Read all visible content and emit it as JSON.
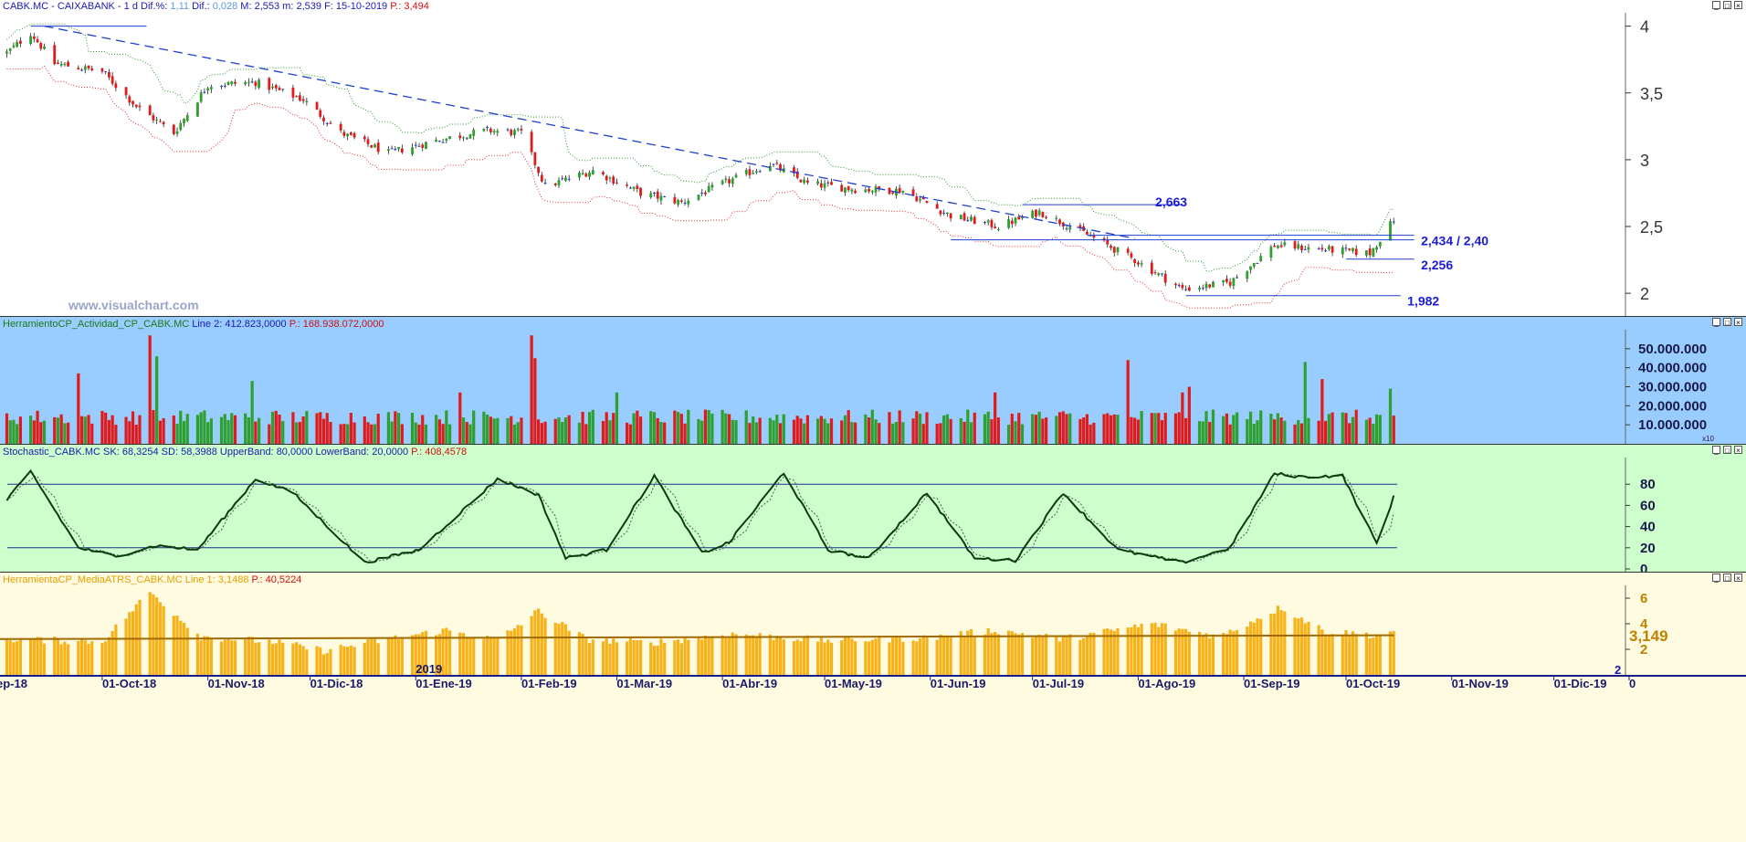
{
  "price_pane": {
    "title_symbol": "CABK.MC - CAIXABANK -",
    "title_period": "1 d",
    "dif_pct_label": "Dif.%:",
    "dif_pct_value": "1,11",
    "dif_label": "Dif.:",
    "dif_value": "0,028",
    "high_label": "M:",
    "high_value": "2,553",
    "low_label": "m:",
    "low_value": "2,539",
    "date_label": "F:",
    "date_value": "15-10-2019",
    "p_label": "P.:",
    "p_value": "3,494",
    "watermark": "www.visualchart.com",
    "yticks": [
      "4",
      "3,5",
      "3",
      "2,5",
      "2"
    ],
    "levels": [
      "2,663",
      "2,434 / 2,40",
      "2,256",
      "1,982"
    ]
  },
  "volume_pane": {
    "title": "HerramientoCP_Actividad_CP_CABK.MC",
    "line_label": "Line 2:",
    "line_value": "412.823,0000",
    "p_label": "P.:",
    "p_value": "168.938.072,0000",
    "yticks": [
      "50.000.000",
      "40.000.000",
      "30.000.000",
      "20.000.000",
      "10.000.000"
    ],
    "unit_tag": "x10"
  },
  "stoch_pane": {
    "title": "Stochastic_CABK.MC",
    "sk_label": "SK:",
    "sk_value": "68,3254",
    "sd_label": "SD:",
    "sd_value": "58,3988",
    "upper_label": "UpperBand:",
    "upper_value": "80,0000",
    "lower_label": "LowerBand:",
    "lower_value": "20,0000",
    "p_label": "P.:",
    "p_value": "408,4578",
    "yticks": [
      "80",
      "60",
      "40",
      "20",
      "0"
    ]
  },
  "atr_pane": {
    "title": "HerramientaCP_MediaATRS_CABK.MC",
    "line_label": "Line 1:",
    "line_value": "3,1488",
    "p_label": "P.:",
    "p_value": "40,5224",
    "yticks": [
      "6",
      "4",
      "2"
    ],
    "last_value": "3,149",
    "year_marker": "2019",
    "corner_value": "2"
  },
  "x_axis": {
    "labels": [
      "ep-18",
      "01-Oct-18",
      "01-Nov-18",
      "01-Dic-18",
      "01-Ene-19",
      "01-Feb-19",
      "01-Mar-19",
      "01-Abr-19",
      "01-May-19",
      "01-Jun-19",
      "01-Jul-19",
      "01-Ago-19",
      "01-Sep-19",
      "01-Oct-19",
      "01-Nov-19",
      "01-Dic-19",
      "0"
    ]
  },
  "colors": {
    "up": "#2ea02e",
    "down": "#e01b1b",
    "neutral": "#1f3fd1",
    "volume_bg": "#99ccff",
    "stoch_bg": "#ccffcc",
    "atr_bg": "#fffbe0",
    "atr_bar": "#f7b21a",
    "level_text": "#1b1bd9"
  },
  "chart_data": [
    {
      "type": "candlestick",
      "title": "CABK.MC - CAIXABANK - 1 d",
      "ylim": [
        1.83,
        4.1
      ],
      "trendline": {
        "from": [
          "2018-09-14",
          4.0
        ],
        "to": [
          "2019-07-31",
          2.41
        ]
      },
      "horizontal_levels": [
        2.663,
        2.434,
        2.4,
        2.256,
        1.982
      ],
      "close_anchors": [
        [
          "2018-09-03",
          3.8
        ],
        [
          "2018-09-10",
          3.95
        ],
        [
          "2018-09-17",
          3.72
        ],
        [
          "2018-10-01",
          3.66
        ],
        [
          "2018-10-11",
          3.4
        ],
        [
          "2018-10-22",
          3.2
        ],
        [
          "2018-11-01",
          3.56
        ],
        [
          "2018-11-15",
          3.58
        ],
        [
          "2018-11-29",
          3.45
        ],
        [
          "2018-12-10",
          3.2
        ],
        [
          "2018-12-24",
          3.05
        ],
        [
          "2019-01-08",
          3.15
        ],
        [
          "2019-01-22",
          3.22
        ],
        [
          "2019-02-01",
          3.2
        ],
        [
          "2019-02-08",
          2.8
        ],
        [
          "2019-02-22",
          2.92
        ],
        [
          "2019-03-08",
          2.75
        ],
        [
          "2019-03-20",
          2.68
        ],
        [
          "2019-04-01",
          2.82
        ],
        [
          "2019-04-15",
          2.97
        ],
        [
          "2019-04-26",
          2.82
        ],
        [
          "2019-05-10",
          2.78
        ],
        [
          "2019-05-24",
          2.77
        ],
        [
          "2019-06-07",
          2.58
        ],
        [
          "2019-06-21",
          2.5
        ],
        [
          "2019-07-03",
          2.61
        ],
        [
          "2019-07-17",
          2.44
        ],
        [
          "2019-07-31",
          2.25
        ],
        [
          "2019-08-14",
          2.03
        ],
        [
          "2019-08-28",
          2.08
        ],
        [
          "2019-09-10",
          2.36
        ],
        [
          "2019-09-24",
          2.33
        ],
        [
          "2019-10-08",
          2.3
        ],
        [
          "2019-10-15",
          2.55
        ]
      ]
    },
    {
      "type": "bar",
      "title": "HerramientoCP_Actividad_CP_CABK.MC",
      "ylim": [
        0,
        60000000
      ],
      "typical_range": [
        10000000,
        18000000
      ],
      "spikes": [
        [
          "2018-09-24",
          37000000
        ],
        [
          "2018-10-15",
          57000000
        ],
        [
          "2018-10-17",
          46000000
        ],
        [
          "2018-11-14",
          33000000
        ],
        [
          "2019-01-14",
          27000000
        ],
        [
          "2019-02-04",
          57000000
        ],
        [
          "2019-02-05",
          45000000
        ],
        [
          "2019-03-01",
          27000000
        ],
        [
          "2019-06-20",
          27000000
        ],
        [
          "2019-07-29",
          44000000
        ],
        [
          "2019-08-14",
          27000000
        ],
        [
          "2019-08-16",
          30000000
        ],
        [
          "2019-09-19",
          43000000
        ],
        [
          "2019-09-24",
          34000000
        ],
        [
          "2019-10-14",
          29000000
        ]
      ]
    },
    {
      "type": "line",
      "title": "Stochastic_CABK.MC",
      "ylim": [
        0,
        100
      ],
      "bands": [
        80,
        20
      ],
      "series": [
        {
          "name": "SK",
          "last": 68.3254
        },
        {
          "name": "SD",
          "last": 58.3988
        }
      ],
      "sk_anchors": [
        [
          "2018-09-03",
          65
        ],
        [
          "2018-09-10",
          92
        ],
        [
          "2018-09-24",
          20
        ],
        [
          "2018-10-05",
          12
        ],
        [
          "2018-10-17",
          22
        ],
        [
          "2018-10-29",
          18
        ],
        [
          "2018-11-15",
          85
        ],
        [
          "2018-11-26",
          72
        ],
        [
          "2018-12-17",
          6
        ],
        [
          "2019-01-02",
          18
        ],
        [
          "2019-01-25",
          85
        ],
        [
          "2019-02-06",
          70
        ],
        [
          "2019-02-14",
          10
        ],
        [
          "2019-02-26",
          18
        ],
        [
          "2019-03-12",
          88
        ],
        [
          "2019-03-26",
          15
        ],
        [
          "2019-04-03",
          25
        ],
        [
          "2019-04-19",
          91
        ],
        [
          "2019-05-02",
          18
        ],
        [
          "2019-05-14",
          10
        ],
        [
          "2019-05-31",
          72
        ],
        [
          "2019-06-14",
          10
        ],
        [
          "2019-06-26",
          8
        ],
        [
          "2019-07-10",
          72
        ],
        [
          "2019-07-26",
          18
        ],
        [
          "2019-08-14",
          6
        ],
        [
          "2019-08-28",
          20
        ],
        [
          "2019-09-10",
          90
        ],
        [
          "2019-09-18",
          87
        ],
        [
          "2019-09-30",
          88
        ],
        [
          "2019-10-10",
          24
        ],
        [
          "2019-10-15",
          68
        ]
      ]
    },
    {
      "type": "bar",
      "title": "HerramientaCP_MediaATRS_CABK.MC",
      "ylim": [
        0,
        7
      ],
      "series": [
        {
          "name": "Line 1",
          "last": 3.1488
        }
      ],
      "atr_anchors": [
        [
          "2018-09-03",
          2.8
        ],
        [
          "2018-10-01",
          2.6
        ],
        [
          "2018-10-15",
          6.5
        ],
        [
          "2018-10-30",
          3.0
        ],
        [
          "2018-11-20",
          2.6
        ],
        [
          "2018-12-05",
          1.9
        ],
        [
          "2018-12-24",
          2.8
        ],
        [
          "2019-01-10",
          3.5
        ],
        [
          "2019-01-25",
          2.7
        ],
        [
          "2019-02-06",
          5.0
        ],
        [
          "2019-02-20",
          2.8
        ],
        [
          "2019-03-10",
          2.5
        ],
        [
          "2019-04-05",
          3.2
        ],
        [
          "2019-05-01",
          2.7
        ],
        [
          "2019-06-01",
          2.9
        ],
        [
          "2019-06-20",
          3.5
        ],
        [
          "2019-07-10",
          2.8
        ],
        [
          "2019-08-05",
          4.0
        ],
        [
          "2019-08-25",
          3.0
        ],
        [
          "2019-09-12",
          5.3
        ],
        [
          "2019-09-25",
          3.4
        ],
        [
          "2019-10-10",
          3.1
        ],
        [
          "2019-10-15",
          3.5
        ]
      ]
    }
  ]
}
